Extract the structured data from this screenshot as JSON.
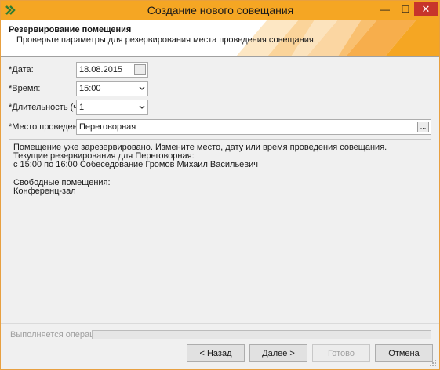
{
  "window": {
    "title": "Создание нового совещания",
    "minimize_glyph": "—",
    "maximize_glyph": "☐",
    "close_glyph": "✕"
  },
  "header": {
    "title": "Резервирование помещения",
    "subtitle": "Проверьте параметры для резервирования места проведения совещания."
  },
  "form": {
    "date_label": "*Дата:",
    "date_value": "18.08.2015",
    "time_label": "*Время:",
    "time_value": "15:00",
    "duration_label": "*Длительность (ч):",
    "duration_value": "1",
    "location_label": "*Место проведения:",
    "location_value": "Переговорная",
    "ellipsis": "..."
  },
  "info": {
    "line1": "Помещение уже зарезервировано. Измените место, дату или время проведения совещания.",
    "line2": "Текущие резервирования для Переговорная:",
    "line3": "с 15:00 по 16:00 Собеседование Громов Михаил Васильевич",
    "free_title": "Свободные помещения:",
    "free_item": "Конференц-зал"
  },
  "status": {
    "label": "Выполняется операция",
    "progress": 0
  },
  "buttons": {
    "back": "< Назад",
    "next": "Далее >",
    "finish": "Готово",
    "cancel": "Отмена"
  },
  "colors": {
    "accent": "#f5a623",
    "close": "#c7342b"
  }
}
